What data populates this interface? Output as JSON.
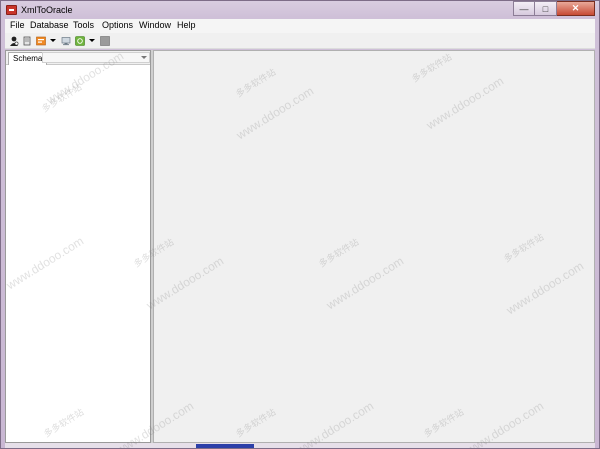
{
  "window": {
    "title": "XmlToOracle"
  },
  "menu": {
    "items": [
      {
        "label": "File"
      },
      {
        "label": "Database"
      },
      {
        "label": "Tools"
      },
      {
        "label": "Options"
      },
      {
        "label": "Window"
      },
      {
        "label": "Help"
      }
    ]
  },
  "toolbar": {
    "icons": [
      "user-icon",
      "scroll-icon",
      "orange-db-icon",
      "monitor-icon",
      "green-run-icon",
      "stop-icon"
    ]
  },
  "left_panel": {
    "tab_label": "Schema"
  },
  "watermark": {
    "url": "www.ddooo.com",
    "cn": "多多软件站"
  },
  "colors": {
    "title_bar": "#cfc0d8",
    "workspace": "#f0f0f0",
    "close": "#c74a34"
  }
}
